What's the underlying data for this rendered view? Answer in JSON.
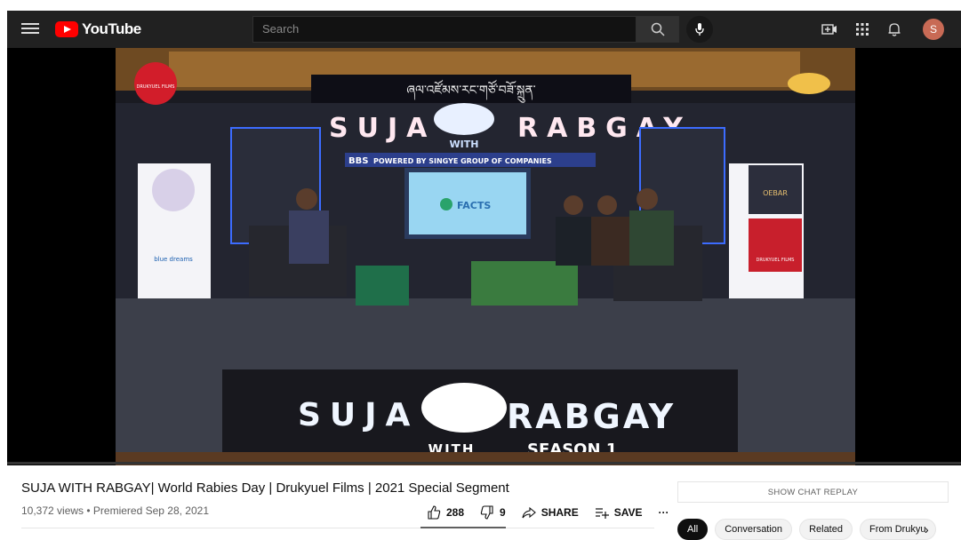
{
  "header": {
    "logo_text": "YouTube",
    "search_placeholder": "Search",
    "avatar_letter": "S"
  },
  "video": {
    "overlay_main_left": "SUJA",
    "overlay_main_right": "RABGAY",
    "overlay_with": "WITH",
    "overlay_season": "SEASON 1",
    "set_title_left": "SUJA",
    "set_title_right": "RABGAY",
    "set_with": "WITH",
    "banner_sponsor": "POWERED BY SINGYE GROUP OF COMPANIES",
    "banner_bbs": "BBS",
    "screen_text": "FACTS",
    "left_standee_text": "blue dreams",
    "right_standee_top": "OEBAR",
    "right_standee_mid": "DRUKYUEL FILMS",
    "watermark_top_left": "DRUKYUEL FILMS",
    "progress_percent": 0
  },
  "info": {
    "title": "SUJA WITH RABGAY| World Rabies Day | Drukyuel Films | 2021 Special Segment",
    "meta": "10,372 views • Premiered Sep 28, 2021",
    "likes": "288",
    "dislikes": "9",
    "share_label": "SHARE",
    "save_label": "SAVE",
    "more_label": "···"
  },
  "sidebar": {
    "chat_replay_label": "SHOW CHAT REPLAY",
    "chips": [
      "All",
      "Conversation",
      "Related",
      "From Drukyu"
    ]
  },
  "colors": {
    "brand_red": "#ff0000",
    "topbar_bg": "#212121",
    "set_neon": "#e6f0ff"
  }
}
